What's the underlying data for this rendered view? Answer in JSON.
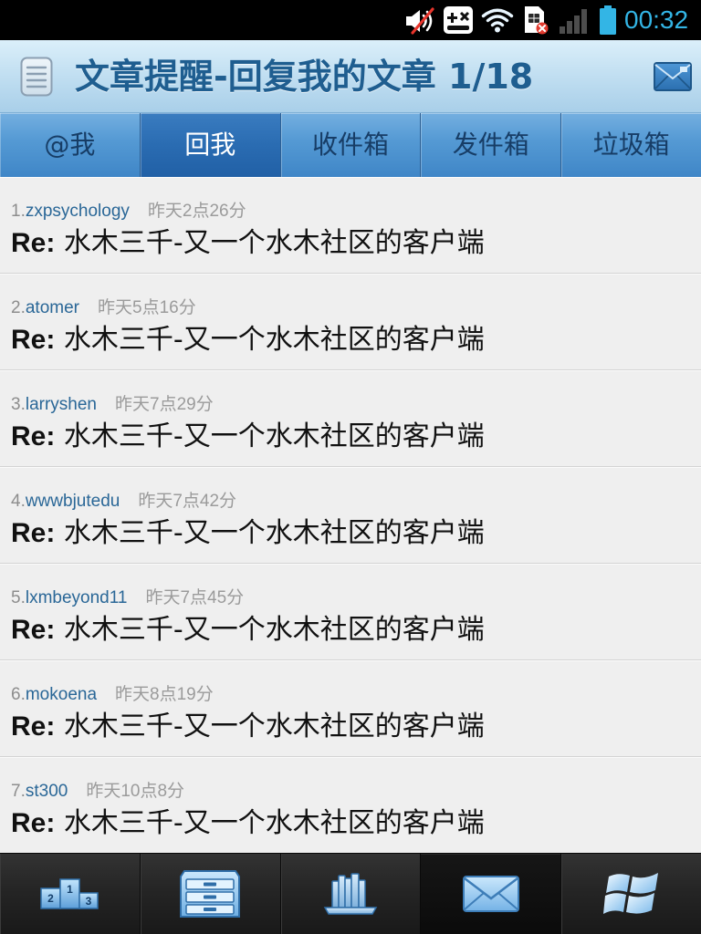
{
  "status_bar": {
    "time": "00:32",
    "icons": [
      "volume-muted-icon",
      "gamepad-notification-icon",
      "wifi-icon",
      "sim-error-icon",
      "signal-icon",
      "battery-icon"
    ]
  },
  "header": {
    "title": "文章提醒-回复我的文章 1/18",
    "left_icon": "list-menu-icon",
    "right_icon": "mail-icon"
  },
  "tabs": [
    {
      "label": "@我",
      "selected": false
    },
    {
      "label": "回我",
      "selected": true
    },
    {
      "label": "收件箱",
      "selected": false
    },
    {
      "label": "发件箱",
      "selected": false
    },
    {
      "label": "垃圾箱",
      "selected": false
    }
  ],
  "replies": [
    {
      "index": "1.",
      "author": "zxpsychology",
      "time": "昨天2点26分",
      "prefix": "Re:",
      "subject": "水木三千-又一个水木社区的客户端"
    },
    {
      "index": "2.",
      "author": "atomer",
      "time": "昨天5点16分",
      "prefix": "Re:",
      "subject": "水木三千-又一个水木社区的客户端"
    },
    {
      "index": "3.",
      "author": "larryshen",
      "time": "昨天7点29分",
      "prefix": "Re:",
      "subject": "水木三千-又一个水木社区的客户端"
    },
    {
      "index": "4.",
      "author": "wwwbjutedu",
      "time": "昨天7点42分",
      "prefix": "Re:",
      "subject": "水木三千-又一个水木社区的客户端"
    },
    {
      "index": "5.",
      "author": "lxmbeyond11",
      "time": "昨天7点45分",
      "prefix": "Re:",
      "subject": "水木三千-又一个水木社区的客户端"
    },
    {
      "index": "6.",
      "author": "mokoena",
      "time": "昨天8点19分",
      "prefix": "Re:",
      "subject": "水木三千-又一个水木社区的客户端"
    },
    {
      "index": "7.",
      "author": "st300",
      "time": "昨天10点8分",
      "prefix": "Re:",
      "subject": "水木三千-又一个水木社区的客户端"
    }
  ],
  "bottom_nav": [
    {
      "icon": "ranking-podium-icon",
      "labels": [
        "2",
        "1",
        "3"
      ],
      "selected": false
    },
    {
      "icon": "cabinet-icon",
      "selected": false
    },
    {
      "icon": "bookshelf-icon",
      "selected": false
    },
    {
      "icon": "mail-icon",
      "selected": true
    },
    {
      "icon": "windows-icon",
      "selected": false
    }
  ],
  "theme": {
    "status_accent": "#33b5e5",
    "header_title": "#1f5e90",
    "author": "#2a6797",
    "tab_selected": "#2a6cb2",
    "list_background": "#efefef"
  }
}
